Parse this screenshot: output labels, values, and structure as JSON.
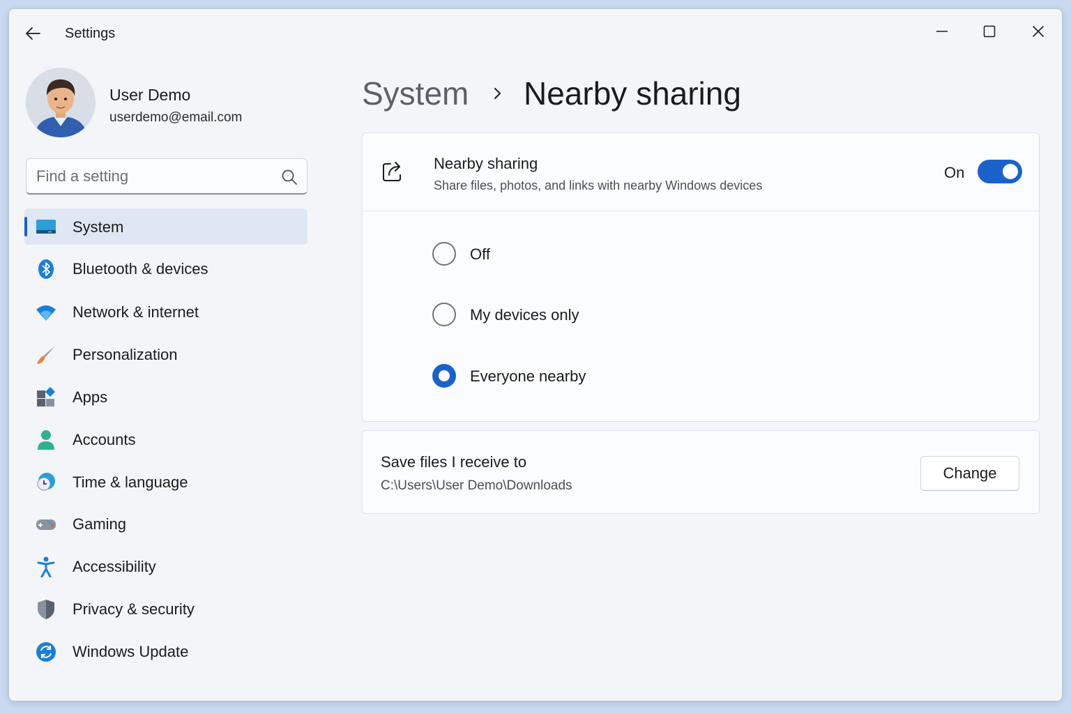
{
  "window": {
    "title": "Settings"
  },
  "profile": {
    "name": "User Demo",
    "email": "userdemo@email.com"
  },
  "search": {
    "placeholder": "Find a setting"
  },
  "sidebar": {
    "items": [
      {
        "label": "System",
        "icon": "system-icon",
        "active": true
      },
      {
        "label": "Bluetooth & devices",
        "icon": "bluetooth-icon"
      },
      {
        "label": "Network & internet",
        "icon": "wifi-icon"
      },
      {
        "label": "Personalization",
        "icon": "brush-icon"
      },
      {
        "label": "Apps",
        "icon": "apps-icon"
      },
      {
        "label": "Accounts",
        "icon": "person-icon"
      },
      {
        "label": "Time & language",
        "icon": "clock-globe-icon"
      },
      {
        "label": "Gaming",
        "icon": "gamepad-icon"
      },
      {
        "label": "Accessibility",
        "icon": "accessibility-icon"
      },
      {
        "label": "Privacy & security",
        "icon": "shield-icon"
      },
      {
        "label": "Windows Update",
        "icon": "update-icon"
      }
    ]
  },
  "header": {
    "parent": "System",
    "current": "Nearby sharing"
  },
  "nearby": {
    "title": "Nearby sharing",
    "description": "Share files, photos, and links with nearby Windows devices",
    "toggle_label": "On",
    "toggle_on": true,
    "options": [
      {
        "label": "Off",
        "checked": false
      },
      {
        "label": "My devices only",
        "checked": false
      },
      {
        "label": "Everyone nearby",
        "checked": true
      }
    ]
  },
  "save": {
    "title": "Save files I receive to",
    "path": "C:\\Users\\User Demo\\Downloads",
    "button_label": "Change"
  },
  "colors": {
    "accent": "#1a62c9",
    "window_bg": "#f3f5f9",
    "card_bg": "#fbfcfd"
  }
}
